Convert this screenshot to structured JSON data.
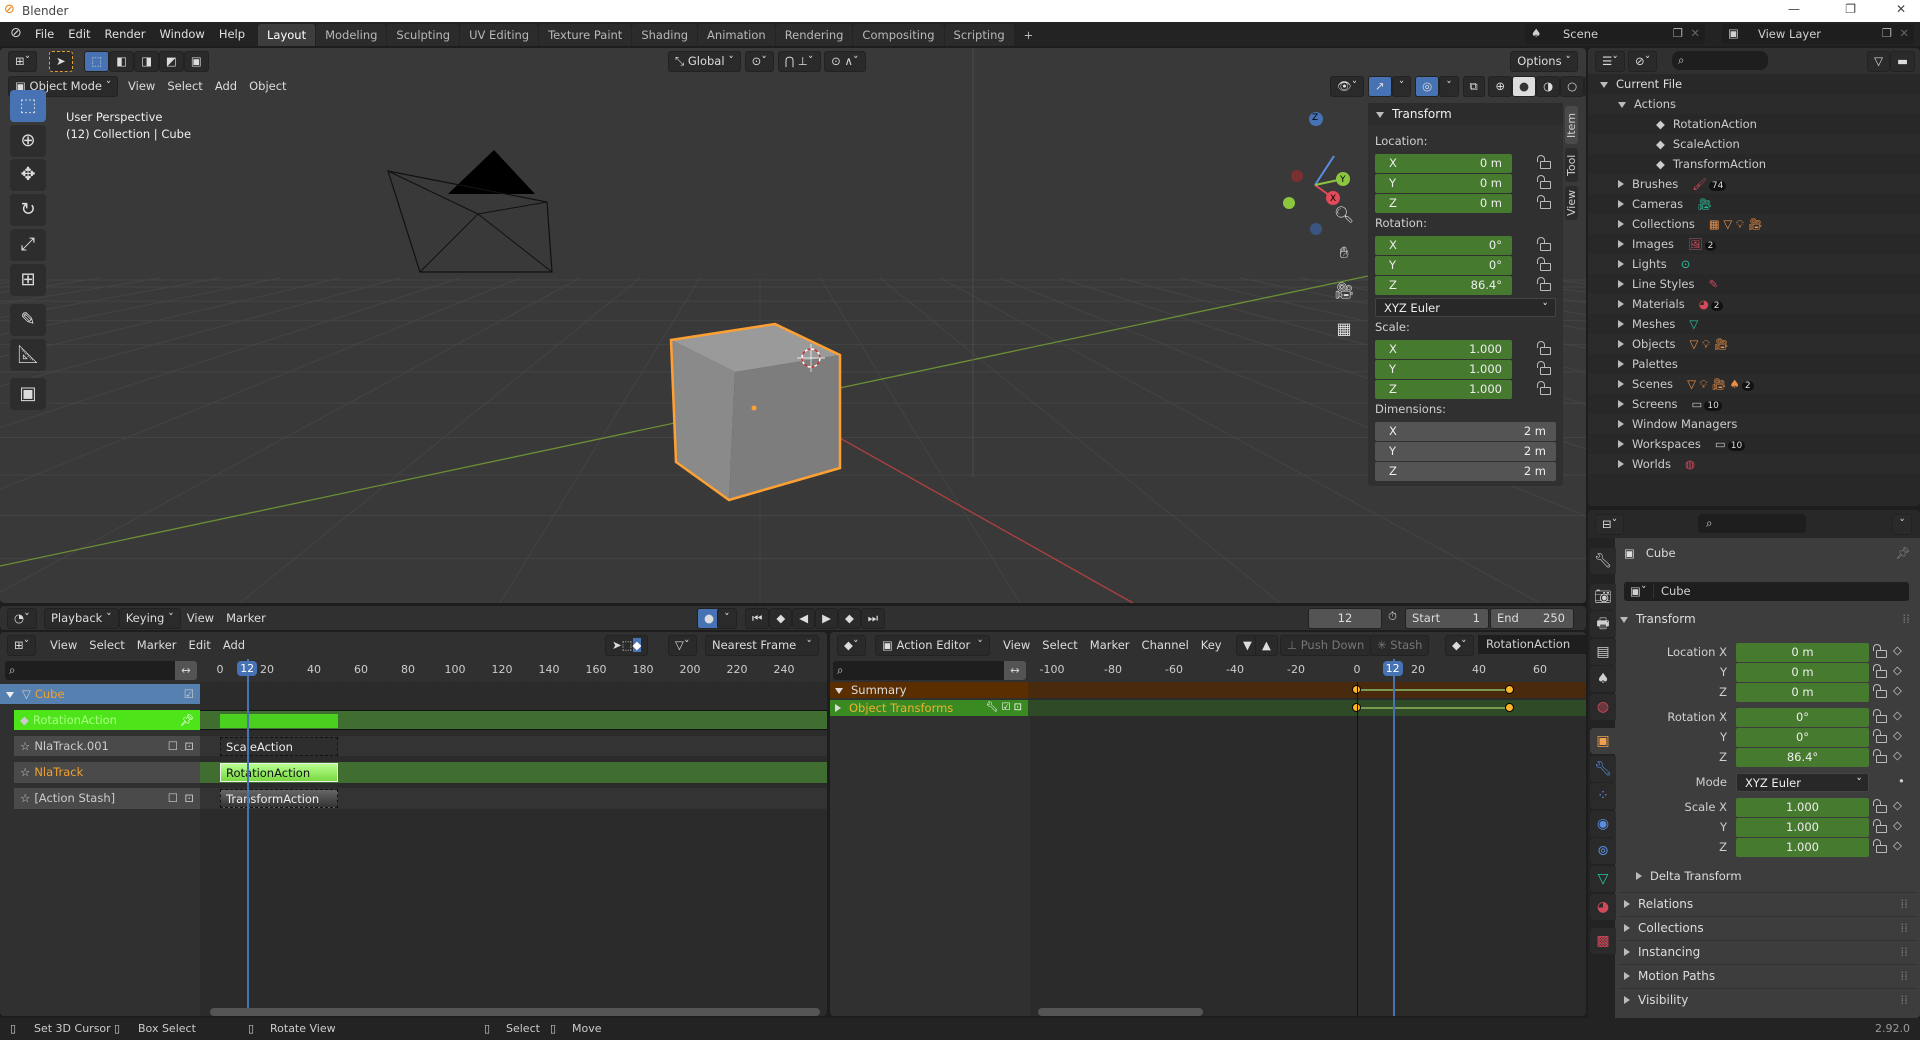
{
  "window": {
    "title": "Blender"
  },
  "menu": [
    "File",
    "Edit",
    "Render",
    "Window",
    "Help"
  ],
  "workspaces": [
    {
      "label": "Layout",
      "active": true
    },
    {
      "label": "Modeling"
    },
    {
      "label": "Sculpting"
    },
    {
      "label": "UV Editing"
    },
    {
      "label": "Texture Paint"
    },
    {
      "label": "Shading"
    },
    {
      "label": "Animation"
    },
    {
      "label": "Rendering"
    },
    {
      "label": "Compositing"
    },
    {
      "label": "Scripting"
    }
  ],
  "add_workspace": "+",
  "scene": {
    "name": "Scene",
    "view_layer": "View Layer"
  },
  "viewport": {
    "transform_orientation": "Global",
    "options": "Options",
    "mode": "Object Mode",
    "menus": [
      "View",
      "Select",
      "Add",
      "Object"
    ],
    "overlay_text": [
      "User Perspective",
      "(12) Collection | Cube"
    ],
    "tools": [
      "select-box-icon",
      "cursor-icon",
      "move-icon",
      "rotate-icon",
      "scale-icon",
      "transform-icon",
      "annotate-icon",
      "measure-icon",
      "add-cube-icon"
    ],
    "gizmo_axes": [
      "X",
      "Y",
      "Z"
    ],
    "side_tabs": [
      "Item",
      "Tool",
      "View"
    ]
  },
  "n_panel": {
    "title": "Transform",
    "location_label": "Location:",
    "rotation_label": "Rotation:",
    "scale_label": "Scale:",
    "dimensions_label": "Dimensions:",
    "location": [
      {
        "axis": "X",
        "value": "0 m"
      },
      {
        "axis": "Y",
        "value": "0 m"
      },
      {
        "axis": "Z",
        "value": "0 m"
      }
    ],
    "rotation": [
      {
        "axis": "X",
        "value": "0°"
      },
      {
        "axis": "Y",
        "value": "0°"
      },
      {
        "axis": "Z",
        "value": "86.4°"
      }
    ],
    "rotation_mode": "XYZ Euler",
    "scale": [
      {
        "axis": "X",
        "value": "1.000"
      },
      {
        "axis": "Y",
        "value": "1.000"
      },
      {
        "axis": "Z",
        "value": "1.000"
      }
    ],
    "dimensions": [
      {
        "axis": "X",
        "value": "2 m"
      },
      {
        "axis": "Y",
        "value": "2 m"
      },
      {
        "axis": "Z",
        "value": "2 m"
      }
    ]
  },
  "outliner": {
    "root": "Current File",
    "items": [
      {
        "label": "Actions",
        "expanded": true,
        "level": 1
      },
      {
        "label": "RotationAction",
        "level": 2
      },
      {
        "label": "ScaleAction",
        "level": 2
      },
      {
        "label": "TransformAction",
        "level": 2
      },
      {
        "label": "Brushes",
        "level": 1,
        "badge": "74"
      },
      {
        "label": "Cameras",
        "level": 1
      },
      {
        "label": "Collections",
        "level": 1
      },
      {
        "label": "Images",
        "level": 1,
        "badge": "2"
      },
      {
        "label": "Lights",
        "level": 1
      },
      {
        "label": "Line Styles",
        "level": 1
      },
      {
        "label": "Materials",
        "level": 1,
        "badge": "2"
      },
      {
        "label": "Meshes",
        "level": 1
      },
      {
        "label": "Objects",
        "level": 1
      },
      {
        "label": "Palettes",
        "level": 1
      },
      {
        "label": "Scenes",
        "level": 1,
        "badge": "2"
      },
      {
        "label": "Screens",
        "level": 1,
        "badge": "10"
      },
      {
        "label": "Window Managers",
        "level": 1
      },
      {
        "label": "Workspaces",
        "level": 1,
        "badge": "10"
      },
      {
        "label": "Worlds",
        "level": 1
      }
    ]
  },
  "properties": {
    "object_name": "Cube",
    "data_name": "Cube",
    "section": "Transform",
    "rows": [
      {
        "label": "Location X",
        "value": "0 m"
      },
      {
        "label": "Y",
        "value": "0 m"
      },
      {
        "label": "Z",
        "value": "0 m"
      },
      {
        "label": "Rotation X",
        "value": "0°"
      },
      {
        "label": "Y",
        "value": "0°"
      },
      {
        "label": "Z",
        "value": "86.4°"
      },
      {
        "label": "Mode",
        "value": "XYZ Euler",
        "dropdown": true
      },
      {
        "label": "Scale X",
        "value": "1.000"
      },
      {
        "label": "Y",
        "value": "1.000"
      },
      {
        "label": "Z",
        "value": "1.000"
      }
    ],
    "subpanel": "Delta Transform",
    "collapsed": [
      "Relations",
      "Collections",
      "Instancing",
      "Motion Paths",
      "Visibility"
    ]
  },
  "timeline": {
    "menus": [
      "Playback",
      "Keying",
      "View",
      "Marker"
    ],
    "current_frame": "12",
    "start_label": "Start",
    "start": "1",
    "end_label": "End",
    "end": "250"
  },
  "nla": {
    "menus": [
      "View",
      "Select",
      "Marker",
      "Edit",
      "Add"
    ],
    "snap": "Nearest Frame",
    "ticks": [
      0,
      20,
      40,
      60,
      80,
      100,
      120,
      140,
      160,
      180,
      200,
      220,
      240
    ],
    "current_frame": 12,
    "channels": [
      {
        "label": "Cube",
        "type": "object"
      },
      {
        "label": "RotationAction",
        "type": "action"
      },
      {
        "label": "NlaTrack.001",
        "type": "track"
      },
      {
        "label": "NlaTrack",
        "type": "track-active"
      },
      {
        "label": "[Action Stash]",
        "type": "track"
      }
    ],
    "strips": [
      {
        "label": "ScaleAction",
        "start": 0,
        "end": 50
      },
      {
        "label": "RotationAction",
        "start": 0,
        "end": 50
      },
      {
        "label": "TransformAction",
        "start": 0,
        "end": 50
      }
    ],
    "action_range": [
      0,
      50
    ]
  },
  "action_editor": {
    "mode": "Action Editor",
    "menus": [
      "View",
      "Select",
      "Marker",
      "Channel",
      "Key"
    ],
    "push_down": "Push Down",
    "stash": "Stash",
    "action": "RotationAction",
    "ticks": [
      -100,
      -80,
      -60,
      -40,
      -20,
      0,
      20,
      40,
      60
    ],
    "current_frame": 12,
    "channels": [
      "Summary",
      "Object Transforms"
    ],
    "keyframes": [
      0,
      50
    ]
  },
  "status": {
    "items": [
      "Set 3D Cursor",
      "Box Select",
      "Rotate View",
      "Select",
      "Move"
    ],
    "version": "2.92.0"
  },
  "colors": {
    "accent": "#4772b3",
    "field_green": "#467a2e",
    "selection": "#ffa033"
  }
}
